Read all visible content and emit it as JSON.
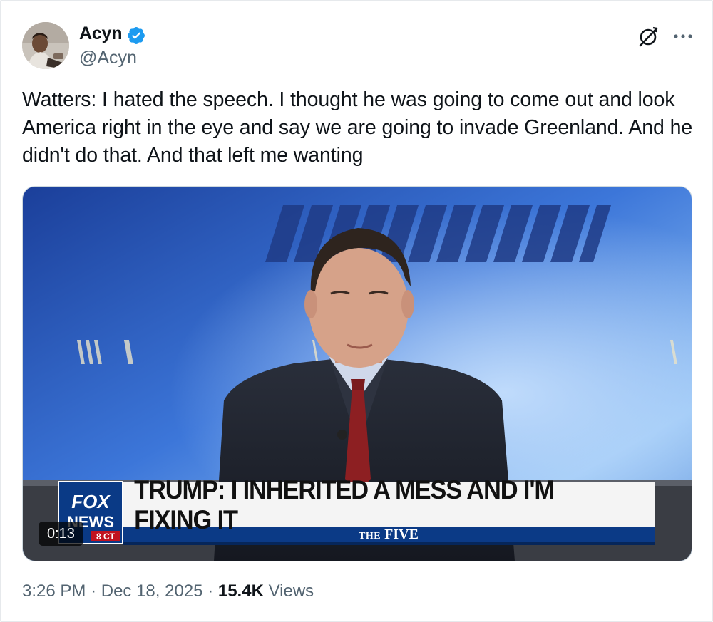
{
  "tweet": {
    "author": {
      "display_name": "Acyn",
      "handle": "@Acyn",
      "verified": true
    },
    "text": "Watters: I hated the speech. I thought he was going to come out and look America right in the eye and say we are going to invade Greenland. And he didn't do that. And that left me wanting",
    "media": {
      "type": "video",
      "duration": "0:13",
      "chyron_headline": "TRUMP: I INHERITED A MESS AND I'M FIXING IT",
      "show_prefix": "THE",
      "show_name": "FIVE",
      "network_logo_line1": "FOX",
      "network_logo_line2": "NEWS",
      "clock_fragment": "8 CT"
    },
    "meta": {
      "time": "3:26 PM",
      "date": "Dec 18, 2025",
      "separator": "·",
      "views_count": "15.4K",
      "views_label": "Views"
    }
  },
  "icons": {
    "verified": "verified-badge-icon",
    "grok": "grok-icon",
    "more": "more-icon"
  },
  "colors": {
    "verified_blue": "#1d9bf0",
    "text_primary": "#0f1419",
    "text_secondary": "#536471",
    "fox_blue": "#0b3a86",
    "tie_red": "#8d1f22"
  }
}
